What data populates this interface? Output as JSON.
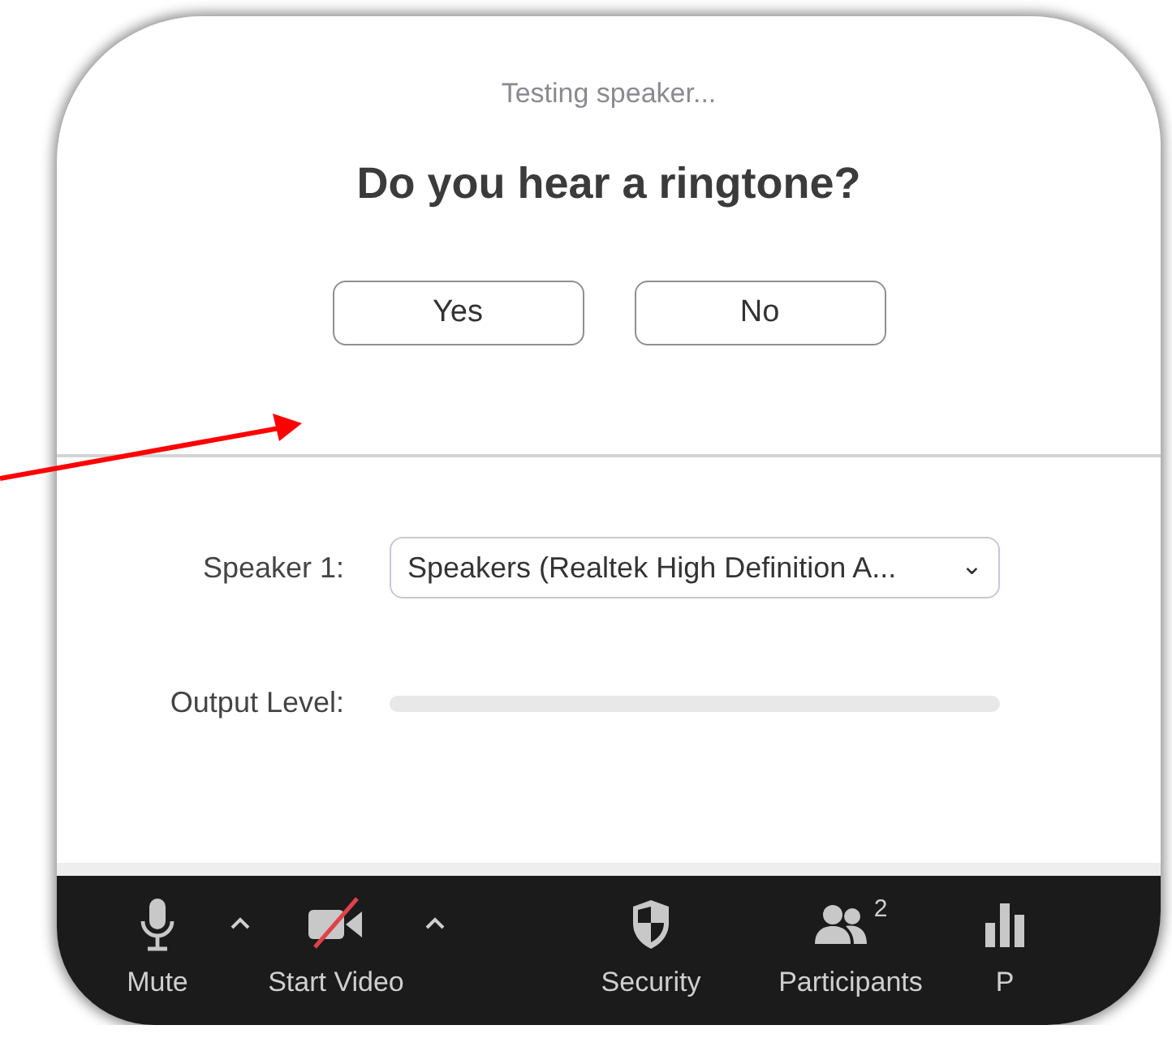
{
  "dialog": {
    "status": "Testing speaker...",
    "question": "Do you hear a ringtone?",
    "buttons": [
      "Yes",
      "No"
    ],
    "speaker": {
      "label": "Speaker 1:",
      "value": "Speakers (Realtek High Definition A...",
      "caret": "⌄"
    },
    "output": {
      "label": "Output Level:",
      "level": 0
    }
  },
  "toolbar": [
    {
      "label": "Mute",
      "kind": "mic",
      "off": false,
      "has_menu": true
    },
    {
      "label": "Start Video",
      "kind": "video",
      "off": true,
      "has_menu": true
    },
    {
      "label": "Security",
      "kind": "shield",
      "off": false,
      "has_menu": false
    },
    {
      "label": "Participants",
      "kind": "people",
      "off": false,
      "has_menu": false,
      "count": "2"
    },
    {
      "label": "P",
      "kind": "chart",
      "off": false,
      "has_menu": false
    }
  ]
}
